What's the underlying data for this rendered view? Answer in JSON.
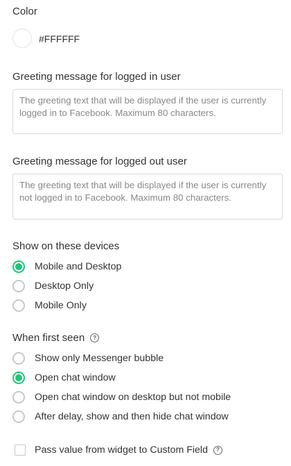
{
  "color": {
    "label": "Color",
    "value": "#FFFFFF"
  },
  "greeting_logged_in": {
    "label": "Greeting message for logged in user",
    "placeholder": "The greeting text that will be displayed if the user is currently logged in to Facebook. Maximum 80 characters."
  },
  "greeting_logged_out": {
    "label": "Greeting message for logged out user",
    "placeholder": "The greeting text that will be displayed if the user is currently not logged in to Facebook. Maximum 80 characters."
  },
  "devices": {
    "label": "Show on these devices",
    "options": [
      {
        "label": "Mobile and Desktop",
        "selected": true
      },
      {
        "label": "Desktop Only",
        "selected": false
      },
      {
        "label": "Mobile Only",
        "selected": false
      }
    ]
  },
  "first_seen": {
    "label": "When first seen",
    "options": [
      {
        "label": "Show only Messenger bubble",
        "selected": false
      },
      {
        "label": "Open chat window",
        "selected": true
      },
      {
        "label": "Open chat window on desktop but not mobile",
        "selected": false
      },
      {
        "label": "After delay, show and then hide chat window",
        "selected": false
      }
    ]
  },
  "pass_value": {
    "label": "Pass value from widget to Custom Field",
    "checked": false
  },
  "colors": {
    "accent": "#1ec776",
    "border": "#d9d9d9"
  }
}
